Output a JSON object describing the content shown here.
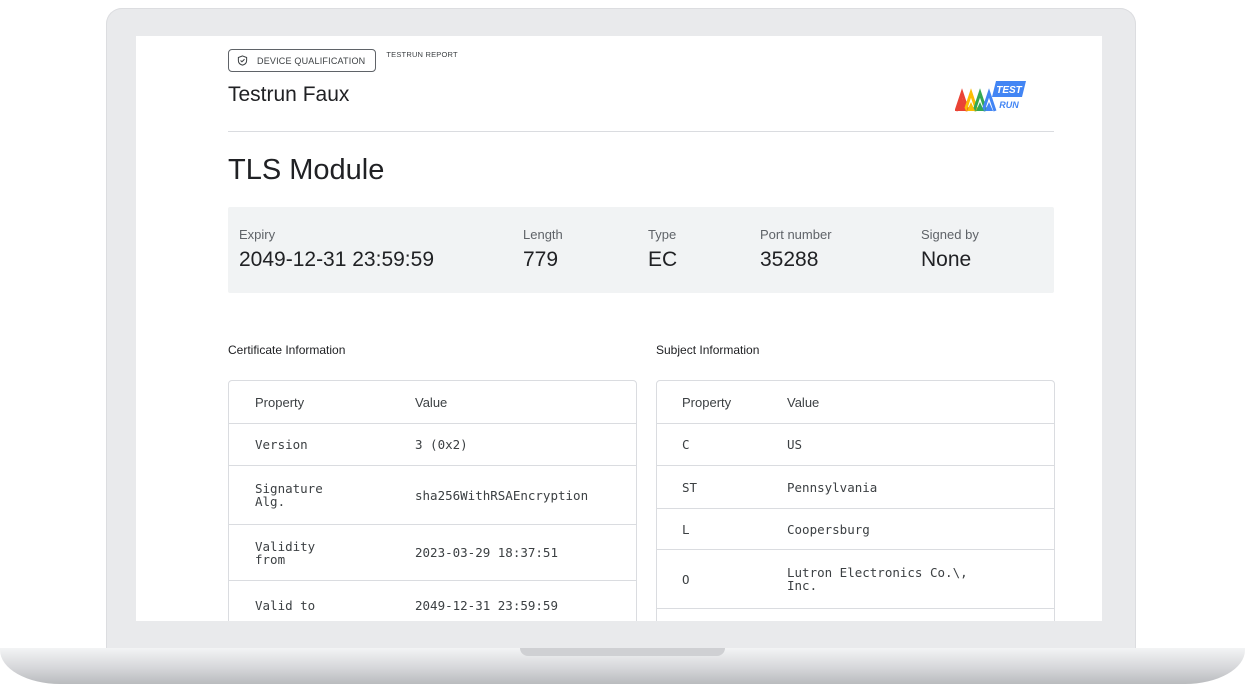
{
  "header": {
    "chip_label": "DEVICE QUALIFICATION",
    "sub_label": "TESTRUN REPORT",
    "device_name": "Testrun Faux",
    "logo": {
      "line1": "TEST",
      "line2": "RUN",
      "icon": "testrun-logo"
    }
  },
  "module_title": "TLS Module",
  "summary": [
    {
      "label": "Expiry",
      "value": "2049-12-31 23:59:59"
    },
    {
      "label": "Length",
      "value": "779"
    },
    {
      "label": "Type",
      "value": "EC"
    },
    {
      "label": "Port number",
      "value": "35288"
    },
    {
      "label": "Signed by",
      "value": "None"
    }
  ],
  "certificate": {
    "title": "Certificate Information",
    "headers": [
      "Property",
      "Value"
    ],
    "rows": [
      [
        "Version",
        "3 (0x2)"
      ],
      [
        "Signature\nAlg.",
        "sha256WithRSAEncryption"
      ],
      [
        "Validity\nfrom",
        "2023-03-29 18:37:51"
      ],
      [
        "Valid to",
        "2049-12-31 23:59:59"
      ]
    ]
  },
  "subject": {
    "title": "Subject Information",
    "headers": [
      "Property",
      "Value"
    ],
    "rows": [
      [
        "C",
        "US"
      ],
      [
        "ST",
        "Pennsylvania"
      ],
      [
        "L",
        "Coopersburg"
      ],
      [
        "O",
        "Lutron Electronics Co.\\,\nInc."
      ]
    ]
  },
  "colors": {
    "summary_bg": "#f1f3f4",
    "border": "#dadce0",
    "text": "#202124"
  }
}
